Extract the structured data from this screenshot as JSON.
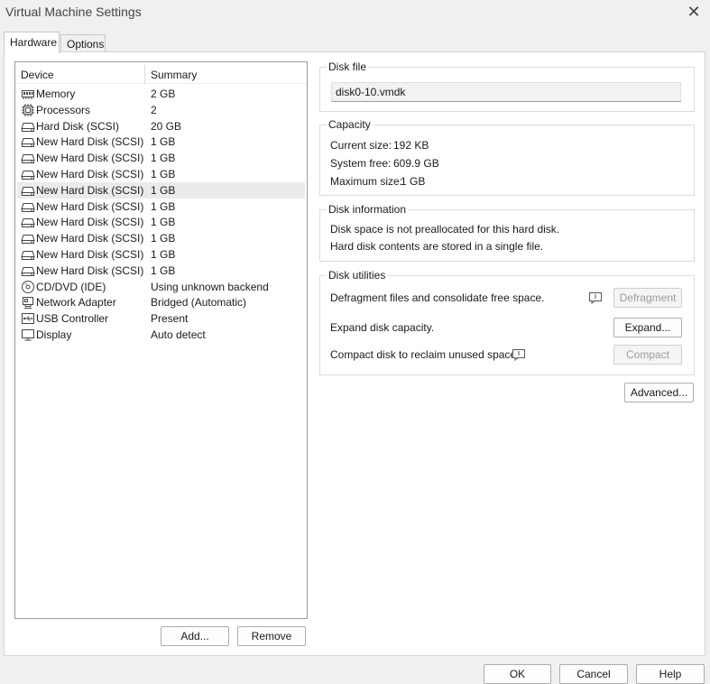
{
  "window": {
    "title": "Virtual Machine Settings",
    "close_glyph": "✕"
  },
  "tabs": [
    {
      "label": "Hardware",
      "active": true
    },
    {
      "label": "Options",
      "active": false
    }
  ],
  "device_list": {
    "headers": {
      "device": "Device",
      "summary": "Summary"
    },
    "items": [
      {
        "icon": "memory-icon",
        "name": "Memory",
        "summary": "2 GB",
        "selected": false
      },
      {
        "icon": "processor-icon",
        "name": "Processors",
        "summary": "2",
        "selected": false
      },
      {
        "icon": "hard-disk-icon",
        "name": "Hard Disk (SCSI)",
        "summary": "20 GB",
        "selected": false
      },
      {
        "icon": "hard-disk-icon",
        "name": "New Hard Disk (SCSI)",
        "summary": "1 GB",
        "selected": false
      },
      {
        "icon": "hard-disk-icon",
        "name": "New Hard Disk (SCSI)",
        "summary": "1 GB",
        "selected": false
      },
      {
        "icon": "hard-disk-icon",
        "name": "New Hard Disk (SCSI)",
        "summary": "1 GB",
        "selected": false
      },
      {
        "icon": "hard-disk-icon",
        "name": "New Hard Disk (SCSI)",
        "summary": "1 GB",
        "selected": true
      },
      {
        "icon": "hard-disk-icon",
        "name": "New Hard Disk (SCSI)",
        "summary": "1 GB",
        "selected": false
      },
      {
        "icon": "hard-disk-icon",
        "name": "New Hard Disk (SCSI)",
        "summary": "1 GB",
        "selected": false
      },
      {
        "icon": "hard-disk-icon",
        "name": "New Hard Disk (SCSI)",
        "summary": "1 GB",
        "selected": false
      },
      {
        "icon": "hard-disk-icon",
        "name": "New Hard Disk (SCSI)",
        "summary": "1 GB",
        "selected": false
      },
      {
        "icon": "hard-disk-icon",
        "name": "New Hard Disk (SCSI)",
        "summary": "1 GB",
        "selected": false
      },
      {
        "icon": "cd-dvd-icon",
        "name": "CD/DVD (IDE)",
        "summary": "Using unknown backend",
        "selected": false
      },
      {
        "icon": "network-adapter-icon",
        "name": "Network Adapter",
        "summary": "Bridged (Automatic)",
        "selected": false
      },
      {
        "icon": "usb-icon",
        "name": "USB Controller",
        "summary": "Present",
        "selected": false
      },
      {
        "icon": "display-icon",
        "name": "Display",
        "summary": "Auto detect",
        "selected": false
      }
    ]
  },
  "list_buttons": {
    "add": "Add...",
    "remove": "Remove"
  },
  "disk_file": {
    "label": "Disk file",
    "value": "disk0-10.vmdk"
  },
  "capacity": {
    "label": "Capacity",
    "current_size_label": "Current size:",
    "current_size": "192 KB",
    "system_free_label": "System free:",
    "system_free": "609.9 GB",
    "maximum_size_label": "Maximum size:",
    "maximum_size": "1 GB"
  },
  "disk_information": {
    "label": "Disk information",
    "line1": "Disk space is not preallocated for this hard disk.",
    "line2": "Hard disk contents are stored in a single file."
  },
  "disk_utilities": {
    "label": "Disk utilities",
    "defragment_text": "Defragment files and consolidate free space.",
    "defragment_button": "Defragment",
    "expand_text": "Expand disk capacity.",
    "expand_button": "Expand...",
    "compact_text": "Compact disk to reclaim unused space.",
    "compact_button": "Compact"
  },
  "advanced_button": "Advanced...",
  "dialog_buttons": {
    "ok": "OK",
    "cancel": "Cancel",
    "help": "Help"
  },
  "colors": {
    "selected_row": "#ebebeb",
    "disabled_text": "#9c9c9c"
  }
}
